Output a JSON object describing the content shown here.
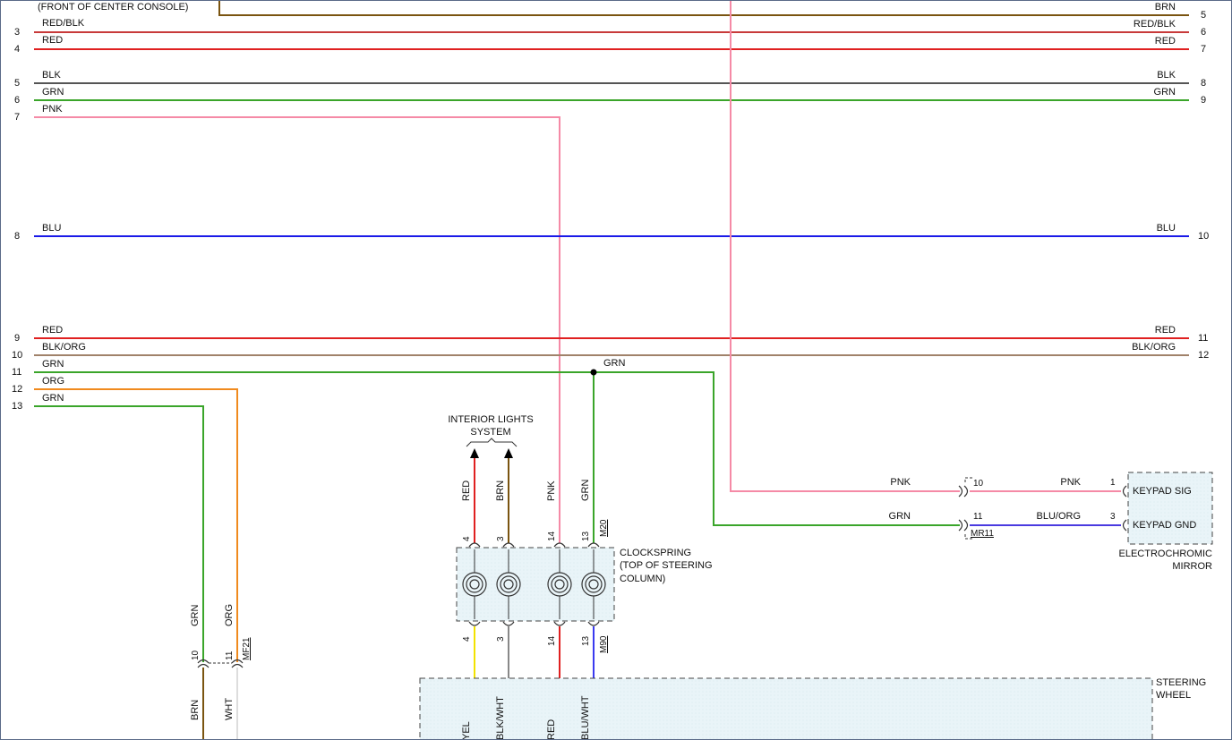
{
  "colors": {
    "RED": "#e02020",
    "BLK": "#555555",
    "GRN": "#3aa52a",
    "PNK": "#f58aa6",
    "BLU": "#1a1ae8",
    "ORG": "#f08a1e",
    "BRN": "#7a5410",
    "YEL": "#f2e200",
    "WHT": "#dddddd",
    "RED_BLK": "#c83a3a",
    "BLK_ORG": "#a0826a",
    "BLU_ORG": "#4a3ae0",
    "BLK_WHT": "#888888",
    "BLU_WHT": "#3a3af0",
    "BOX_FILL": "#e9f4f8",
    "DASH": "#444444"
  },
  "top_label": "(FRONT OF CENTER CONSOLE)",
  "bus_wires": [
    {
      "id": "brn",
      "left_label": "",
      "right_label": "BRN",
      "left_pin": "",
      "right_pin": "5"
    },
    {
      "id": "red-blk",
      "left_label": "RED/BLK",
      "right_label": "RED/BLK",
      "left_pin": "3",
      "right_pin": "6"
    },
    {
      "id": "red",
      "left_label": "RED",
      "right_label": "RED",
      "left_pin": "4",
      "right_pin": "7"
    },
    {
      "id": "blk",
      "left_label": "BLK",
      "right_label": "BLK",
      "left_pin": "5",
      "right_pin": "8"
    },
    {
      "id": "grn",
      "left_label": "GRN",
      "right_label": "GRN",
      "left_pin": "6",
      "right_pin": "9"
    },
    {
      "id": "pnk",
      "left_label": "PNK",
      "right_label": "",
      "left_pin": "7",
      "right_pin": ""
    },
    {
      "id": "blu",
      "left_label": "BLU",
      "right_label": "BLU",
      "left_pin": "8",
      "right_pin": "10"
    },
    {
      "id": "red-2",
      "left_label": "RED",
      "right_label": "RED",
      "left_pin": "9",
      "right_pin": "11"
    },
    {
      "id": "blk-org",
      "left_label": "BLK/ORG",
      "right_label": "BLK/ORG",
      "left_pin": "10",
      "right_pin": "12"
    },
    {
      "id": "grn-2",
      "left_label": "GRN",
      "right_label": "",
      "left_pin": "11",
      "right_pin": ""
    },
    {
      "id": "org",
      "left_label": "ORG",
      "right_label": "",
      "left_pin": "12",
      "right_pin": ""
    },
    {
      "id": "grn-3",
      "left_label": "GRN",
      "right_label": "",
      "left_pin": "13",
      "right_pin": ""
    }
  ],
  "splice": {
    "label": "GRN"
  },
  "interior_lights": {
    "line1": "INTERIOR LIGHTS",
    "line2": "SYSTEM"
  },
  "clockspring": {
    "line1": "CLOCKSPRING",
    "line2": "(TOP OF STEERING",
    "line3": "COLUMN)",
    "top_connector": "M20",
    "bottom_connector": "M90",
    "top_wires": [
      {
        "color": "RED",
        "pin": "4"
      },
      {
        "color": "BRN",
        "pin": "3"
      },
      {
        "color": "PNK",
        "pin": "14"
      },
      {
        "color": "GRN",
        "pin": "13"
      }
    ],
    "bottom_wires": [
      {
        "color": "YEL",
        "pin": "4"
      },
      {
        "color": "BLK/WHT",
        "pin": "3"
      },
      {
        "color": "RED",
        "pin": "14"
      },
      {
        "color": "BLU/WHT",
        "pin": "13"
      }
    ]
  },
  "mr11": {
    "name": "MR11",
    "rows": [
      {
        "in_color": "PNK",
        "pin": "10",
        "out_color": "PNK",
        "mirror_pin": "1",
        "mirror_label": "KEYPAD SIG"
      },
      {
        "in_color": "GRN",
        "pin": "11",
        "out_color": "BLU/ORG",
        "mirror_pin": "3",
        "mirror_label": "KEYPAD GND"
      }
    ]
  },
  "mirror": {
    "line1": "ELECTROCHROMIC",
    "line2": "MIRROR"
  },
  "mf21": {
    "name": "MF21",
    "wires": [
      {
        "top_color": "GRN",
        "pin": "10",
        "bottom_color": "BRN"
      },
      {
        "top_color": "ORG",
        "pin": "11",
        "bottom_color": "WHT"
      }
    ]
  },
  "steering_wheel": {
    "line1": "STEERING",
    "line2": "WHEEL"
  }
}
